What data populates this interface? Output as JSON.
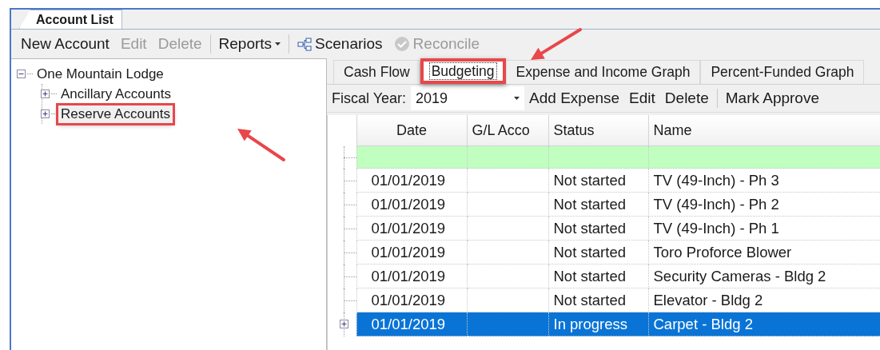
{
  "window": {
    "tab": "Account List"
  },
  "toolbar": [
    {
      "kind": "command",
      "label": "New Account",
      "disabled": false
    },
    {
      "kind": "command",
      "label": "Edit",
      "disabled": true
    },
    {
      "kind": "command",
      "label": "Delete",
      "disabled": true
    },
    {
      "kind": "separator"
    },
    {
      "kind": "menu",
      "label": "Reports",
      "disabled": false
    },
    {
      "kind": "separator"
    },
    {
      "kind": "diagram",
      "label": "Scenarios",
      "disabled": false
    },
    {
      "kind": "check",
      "label": "Reconcile",
      "disabled": true
    }
  ],
  "tree": [
    {
      "label": "One Mountain Lodge",
      "expanded": true,
      "annotated": false,
      "children": [
        {
          "label": "Ancillary Accounts",
          "expanded": false,
          "annotated": false
        },
        {
          "label": "Reserve Accounts",
          "expanded": false,
          "annotated": true
        }
      ]
    }
  ],
  "tabs": [
    {
      "label": "Cash Flow",
      "selected": false,
      "annotated": false
    },
    {
      "label": "Budgeting",
      "selected": true,
      "annotated": true
    },
    {
      "label": "Expense and Income Graph",
      "selected": false,
      "annotated": false
    },
    {
      "label": "Percent-Funded Graph",
      "selected": false,
      "annotated": false
    }
  ],
  "budget_toolbar": {
    "fiscal_year_label": "Fiscal Year:",
    "fiscal_year": "2019",
    "commands": [
      {
        "kind": "command",
        "label": "Add Expense"
      },
      {
        "kind": "command",
        "label": "Edit"
      },
      {
        "kind": "command",
        "label": "Delete"
      },
      {
        "kind": "separator"
      },
      {
        "kind": "command",
        "label": "Mark Approve"
      }
    ]
  },
  "table": {
    "columns": [
      "Date",
      "G/L Acco",
      "Status",
      "Name"
    ],
    "rows": [
      {
        "kind": "new",
        "cells": [
          "",
          "",
          "",
          ""
        ],
        "selected": false,
        "expandable": false
      },
      {
        "kind": "data",
        "cells": [
          "01/01/2019",
          "",
          "Not started",
          "TV (49-Inch) - Ph 3"
        ],
        "selected": false,
        "expandable": false
      },
      {
        "kind": "data",
        "cells": [
          "01/01/2019",
          "",
          "Not started",
          "TV (49-Inch) - Ph 2"
        ],
        "selected": false,
        "expandable": false
      },
      {
        "kind": "data",
        "cells": [
          "01/01/2019",
          "",
          "Not started",
          "TV (49-Inch) - Ph 1"
        ],
        "selected": false,
        "expandable": false
      },
      {
        "kind": "data",
        "cells": [
          "01/01/2019",
          "",
          "Not started",
          "Toro Proforce Blower"
        ],
        "selected": false,
        "expandable": false
      },
      {
        "kind": "data",
        "cells": [
          "01/01/2019",
          "",
          "Not started",
          "Security Cameras - Bldg 2"
        ],
        "selected": false,
        "expandable": false
      },
      {
        "kind": "data",
        "cells": [
          "01/01/2019",
          "",
          "Not started",
          "Elevator - Bldg 2"
        ],
        "selected": false,
        "expandable": false
      },
      {
        "kind": "data",
        "cells": [
          "01/01/2019",
          "",
          "In progress",
          "Carpet - Bldg 2"
        ],
        "selected": true,
        "expandable": true
      }
    ]
  }
}
